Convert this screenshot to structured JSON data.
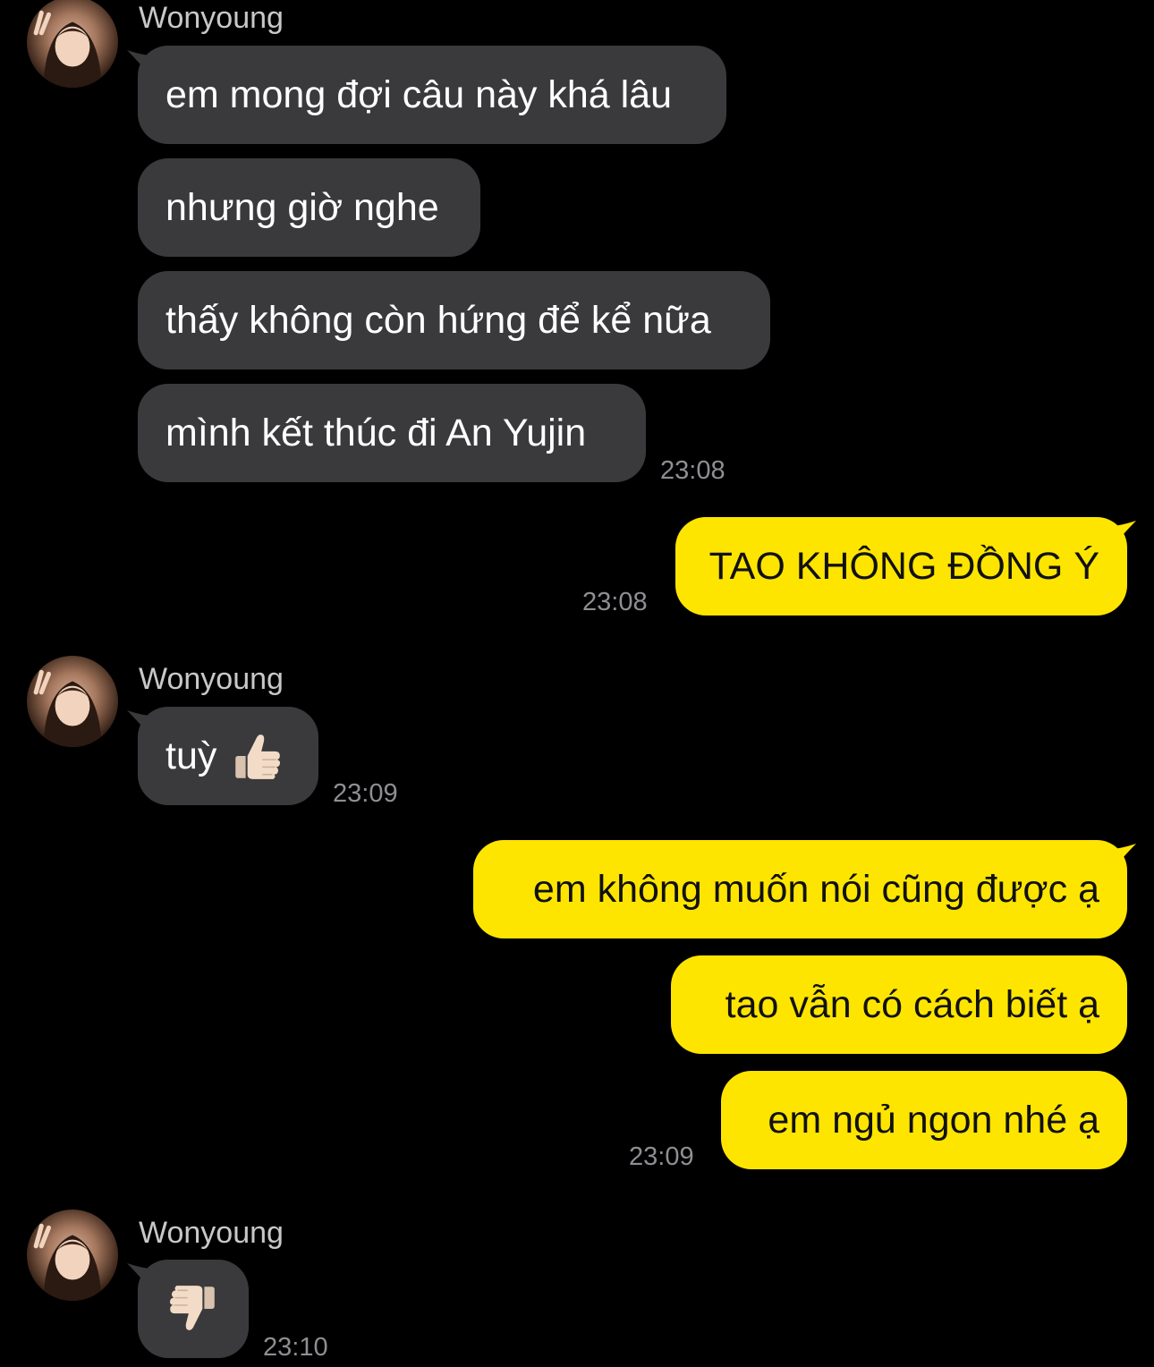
{
  "colors": {
    "background": "#000000",
    "incoming_bubble": "#3a3a3c",
    "outgoing_bubble": "#fee500",
    "timestamp": "#8e8e93",
    "sender_name": "#c8c8c8"
  },
  "groups": [
    {
      "sender": "Wonyoung",
      "messages": [
        "em mong đợi câu này khá lâu",
        "nhưng giờ nghe",
        "thấy không còn hứng để kể nữa",
        "mình kết thúc đi An Yujin"
      ],
      "time": "23:08"
    },
    {
      "messages": [
        "TAO KHÔNG ĐỒNG Ý"
      ],
      "time": "23:08"
    },
    {
      "sender": "Wonyoung",
      "messages": [
        "tuỳ"
      ],
      "emoji": "thumbs-up",
      "time": "23:09"
    },
    {
      "messages": [
        "em không muốn nói cũng được ạ",
        "tao vẫn có cách biết ạ",
        "em ngủ ngon nhé ạ"
      ],
      "time": "23:09"
    },
    {
      "sender": "Wonyoung",
      "emoji": "thumbs-down",
      "time": "23:10"
    }
  ]
}
